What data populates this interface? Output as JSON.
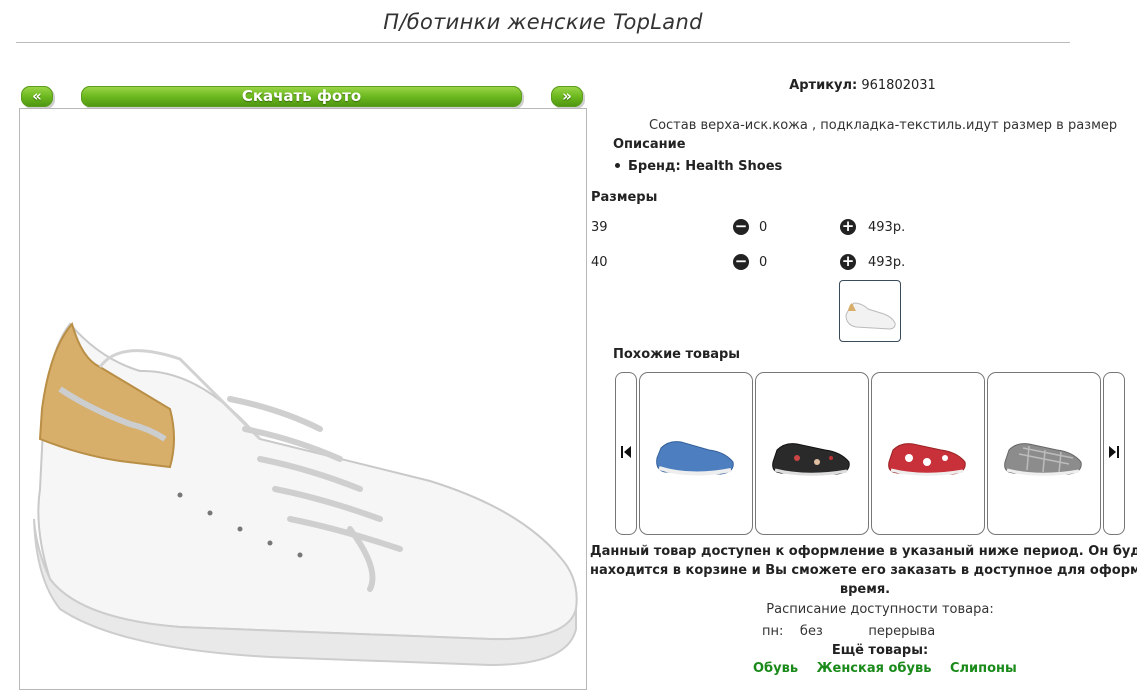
{
  "page": {
    "title": "П/ботинки женские TopLand"
  },
  "gallery": {
    "prev_label": "«",
    "download_label": "Скачать фото",
    "next_label": "»"
  },
  "product": {
    "article_label": "Артикул:",
    "article_value": "961802031",
    "composition": "Состав верха-иск.кожа , подкладка-текстиль.идут размер в размер",
    "description_heading": "Описание",
    "brand_line": "Бренд: Health Shoes",
    "sizes_heading": "Размеры",
    "sizes": [
      {
        "size": "39",
        "qty": "0",
        "price": "493р."
      },
      {
        "size": "40",
        "qty": "0",
        "price": "493р."
      }
    ]
  },
  "similar": {
    "heading": "Похожие товары",
    "items": [
      {
        "name": "blue-slip-on",
        "color": "#4d7fc0"
      },
      {
        "name": "black-floral-slip-on",
        "color": "#2a2a2a"
      },
      {
        "name": "red-floral-slip-on",
        "color": "#c8303a"
      },
      {
        "name": "grey-check-slip-on",
        "color": "#8c8c8c"
      }
    ]
  },
  "availability": {
    "line1": "Данный товар доступен к оформление в указаный ниже период. Он будет",
    "line2": "находится в корзине и Вы сможете его заказать в доступное для оформлени",
    "line3": "время.",
    "schedule_heading": "Расписание доступности товара:",
    "schedule_day": "пн:",
    "schedule_from": "без",
    "schedule_to": "перерыва"
  },
  "more": {
    "heading": "Ещё товары:",
    "links": [
      "Обувь",
      "Женская обувь",
      "Слипоны"
    ]
  },
  "colors": {
    "accent_green": "#6cb81f",
    "link_green": "#1a8a1a"
  }
}
